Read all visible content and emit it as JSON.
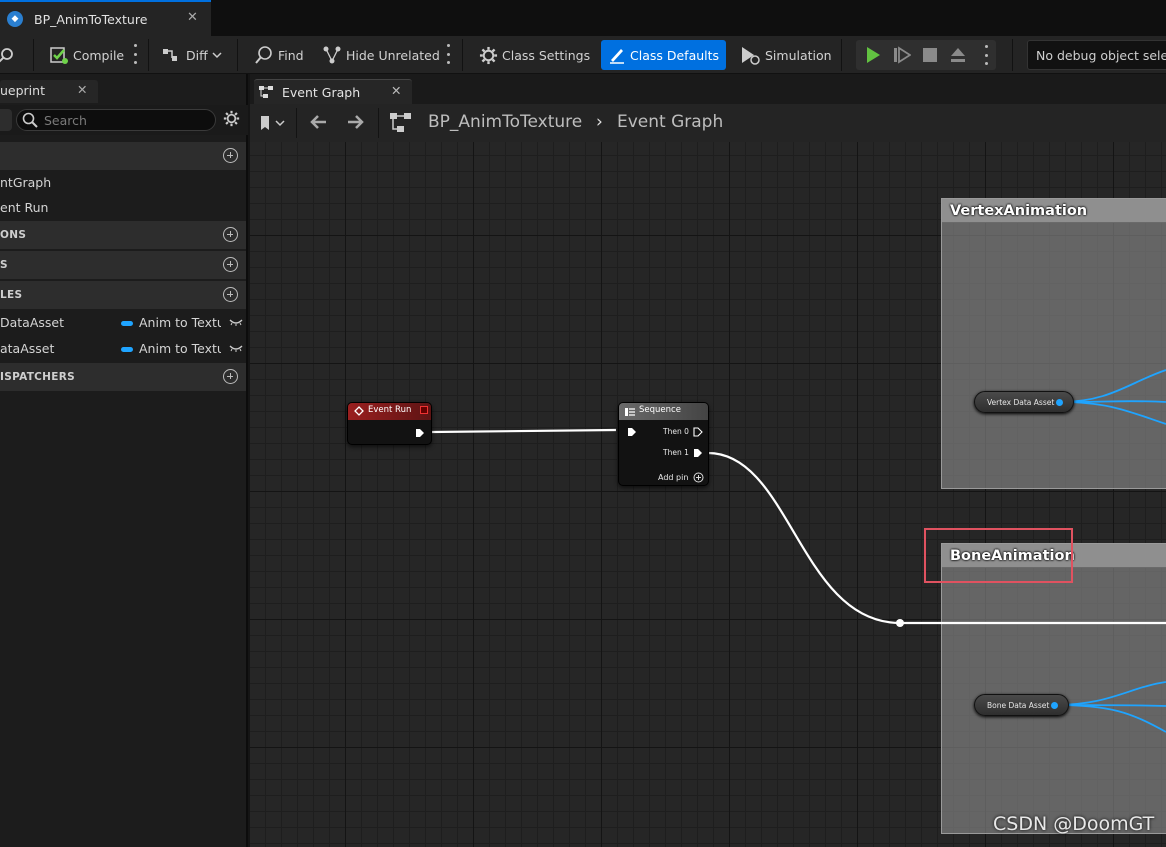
{
  "window": {
    "tab_title": "BP_AnimToTexture"
  },
  "toolbar": {
    "compile": "Compile",
    "diff": "Diff",
    "find": "Find",
    "hide_unrelated": "Hide Unrelated",
    "class_settings": "Class Settings",
    "class_defaults": "Class Defaults",
    "simulation": "Simulation",
    "debug_object": "No debug object selected"
  },
  "left_panel": {
    "tab_label": "ueprint",
    "search_placeholder": "Search",
    "sections": [
      "",
      "ONS",
      "S",
      "LES",
      "ISPATCHERS"
    ],
    "graph_items": [
      "ntGraph",
      "ent Run"
    ],
    "variables": [
      {
        "name": "DataAsset",
        "type": "Anim to Textur"
      },
      {
        "name": "ataAsset",
        "type": "Anim to Textur"
      }
    ]
  },
  "graph": {
    "tab": "Event Graph",
    "breadcrumb": {
      "blueprint": "BP_AnimToTexture",
      "separator": "›",
      "graph": "Event Graph"
    },
    "comments": [
      "VertexAnimation",
      "BoneAnimation"
    ],
    "nodes": {
      "event": {
        "title": "Event Run"
      },
      "sequence": {
        "title": "Sequence",
        "pins": [
          "Then 0",
          "Then 1"
        ],
        "add_pin": "Add pin"
      },
      "vertex_var": "Vertex Data Asset",
      "bone_var": "Bone Data Asset"
    }
  },
  "colors": {
    "accent_blue": "#0070e0",
    "event_header": "#8a1c1c",
    "sequence_header": "#5a5a5a",
    "object_pin": "#1fa4ff",
    "highlight": "#e05260"
  },
  "watermark": "CSDN @DoomGT"
}
